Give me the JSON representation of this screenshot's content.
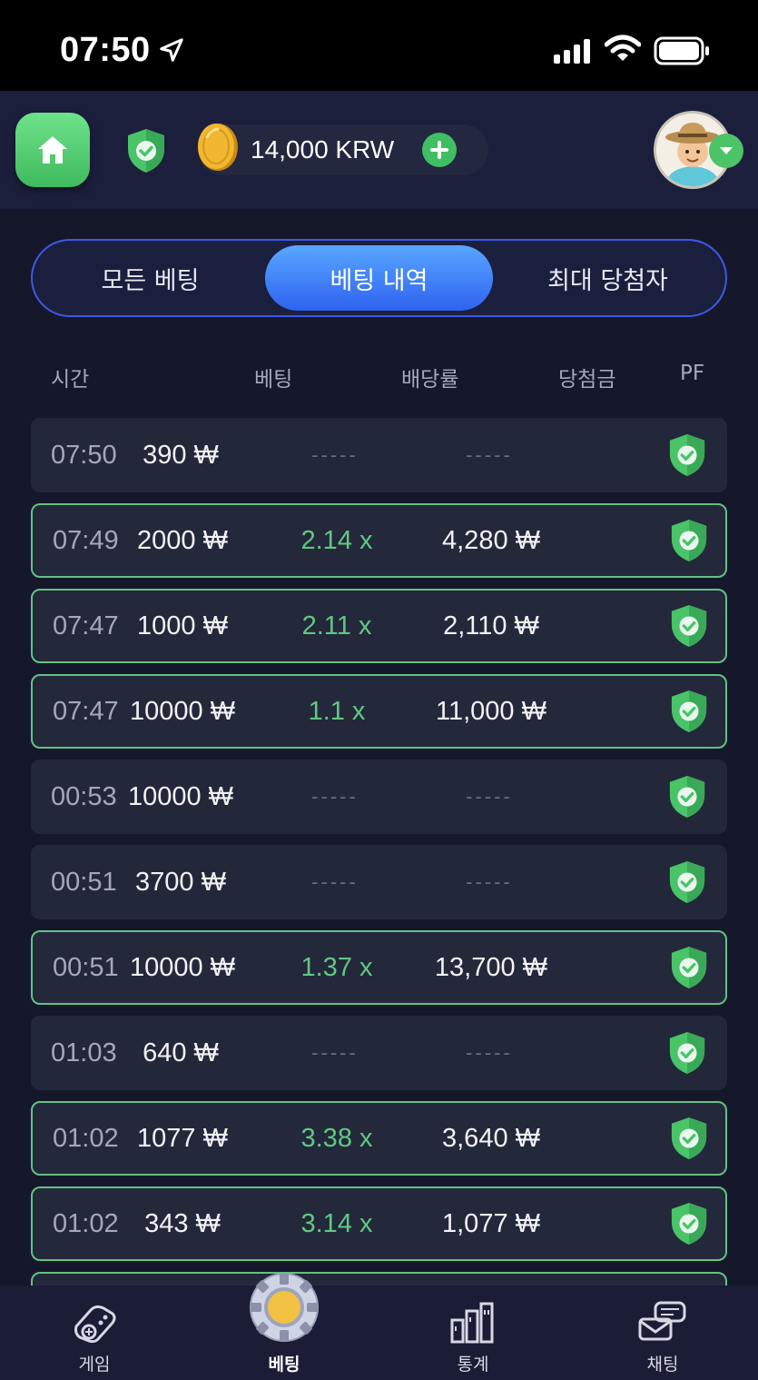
{
  "status_bar": {
    "time": "07:50",
    "icons": [
      "location-arrow-icon",
      "signal-icon",
      "wifi-icon",
      "battery-icon"
    ]
  },
  "header": {
    "balance": "14,000 KRW",
    "icons": [
      "home-icon",
      "shield-check-icon",
      "coin-icon",
      "plus-icon",
      "avatar",
      "chevron-down-icon"
    ]
  },
  "tabs": [
    {
      "label": "모든 베팅",
      "active": false
    },
    {
      "label": "베팅 내역",
      "active": true
    },
    {
      "label": "최대 당첨자",
      "active": false
    }
  ],
  "table": {
    "headers": {
      "time": "시간",
      "bet": "베팅",
      "multiplier": "배당률",
      "payout": "당첨금",
      "pf": "PF"
    },
    "empty_placeholder": "-----",
    "rows": [
      {
        "time": "07:50",
        "bet": "390 ₩",
        "multiplier": "",
        "payout": "",
        "win": false
      },
      {
        "time": "07:49",
        "bet": "2000 ₩",
        "multiplier": "2.14 x",
        "payout": "4,280 ₩",
        "win": true
      },
      {
        "time": "07:47",
        "bet": "1000 ₩",
        "multiplier": "2.11 x",
        "payout": "2,110 ₩",
        "win": true
      },
      {
        "time": "07:47",
        "bet": "10000 ₩",
        "multiplier": "1.1 x",
        "payout": "11,000 ₩",
        "win": true
      },
      {
        "time": "00:53",
        "bet": "10000 ₩",
        "multiplier": "",
        "payout": "",
        "win": false
      },
      {
        "time": "00:51",
        "bet": "3700 ₩",
        "multiplier": "",
        "payout": "",
        "win": false
      },
      {
        "time": "00:51",
        "bet": "10000 ₩",
        "multiplier": "1.37 x",
        "payout": "13,700 ₩",
        "win": true
      },
      {
        "time": "01:03",
        "bet": "640 ₩",
        "multiplier": "",
        "payout": "",
        "win": false
      },
      {
        "time": "01:02",
        "bet": "1077 ₩",
        "multiplier": "3.38 x",
        "payout": "3,640 ₩",
        "win": true
      },
      {
        "time": "01:02",
        "bet": "343 ₩",
        "multiplier": "3.14 x",
        "payout": "1,077 ₩",
        "win": true
      }
    ]
  },
  "colors": {
    "background": "#15182b",
    "accent_blue": "#3f58e6",
    "win_green": "#5fc981",
    "row_bg": "#23273a"
  },
  "bottom_nav": [
    {
      "label": "게임",
      "icon": "joystick-icon",
      "active": false
    },
    {
      "label": "베팅",
      "icon": "poker-chip-icon",
      "active": true
    },
    {
      "label": "통계",
      "icon": "stats-buildings-icon",
      "active": false
    },
    {
      "label": "채팅",
      "icon": "chat-icon",
      "active": false
    }
  ]
}
